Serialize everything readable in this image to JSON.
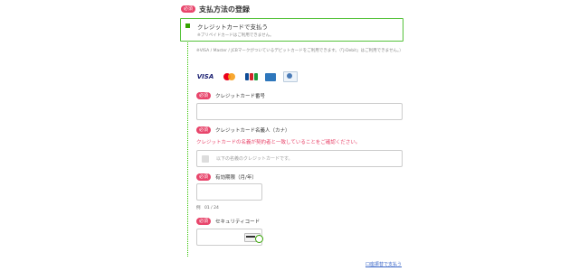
{
  "section": {
    "badge": "必須",
    "title": "支払方法の登録"
  },
  "payment_method": {
    "label": "クレジットカードで支払う",
    "note": "※プリペイドカードはご利用できません。"
  },
  "card_notice": "※VISA / Master / JCBマークがついているデビットカードをご利用できます。（「J-Debit」はご利用できません。）",
  "brands": [
    "VISA",
    "mastercard",
    "JCB",
    "AMEX",
    "Diners"
  ],
  "fields": {
    "card_number": {
      "badge": "必須",
      "label": "クレジットカード番号",
      "value": ""
    },
    "card_holder": {
      "badge": "必須",
      "label": "クレジットカード名義人（カナ）",
      "warning": "クレジットカードの名義が契約者と一致していることをご確認ください。",
      "checkbox_label": "以下の名義のクレジットカードです。"
    },
    "expiry": {
      "badge": "必須",
      "label": "有効期限（月/年）",
      "example": "例　01 / 24",
      "value": ""
    },
    "security_code": {
      "badge": "必須",
      "label": "セキュリティコード",
      "value": ""
    }
  },
  "footer": {
    "link": "口座振替で支払う"
  },
  "colors": {
    "accent_green": "#34c300",
    "badge_pink": "#e8456b",
    "link_blue": "#3a66c8"
  }
}
